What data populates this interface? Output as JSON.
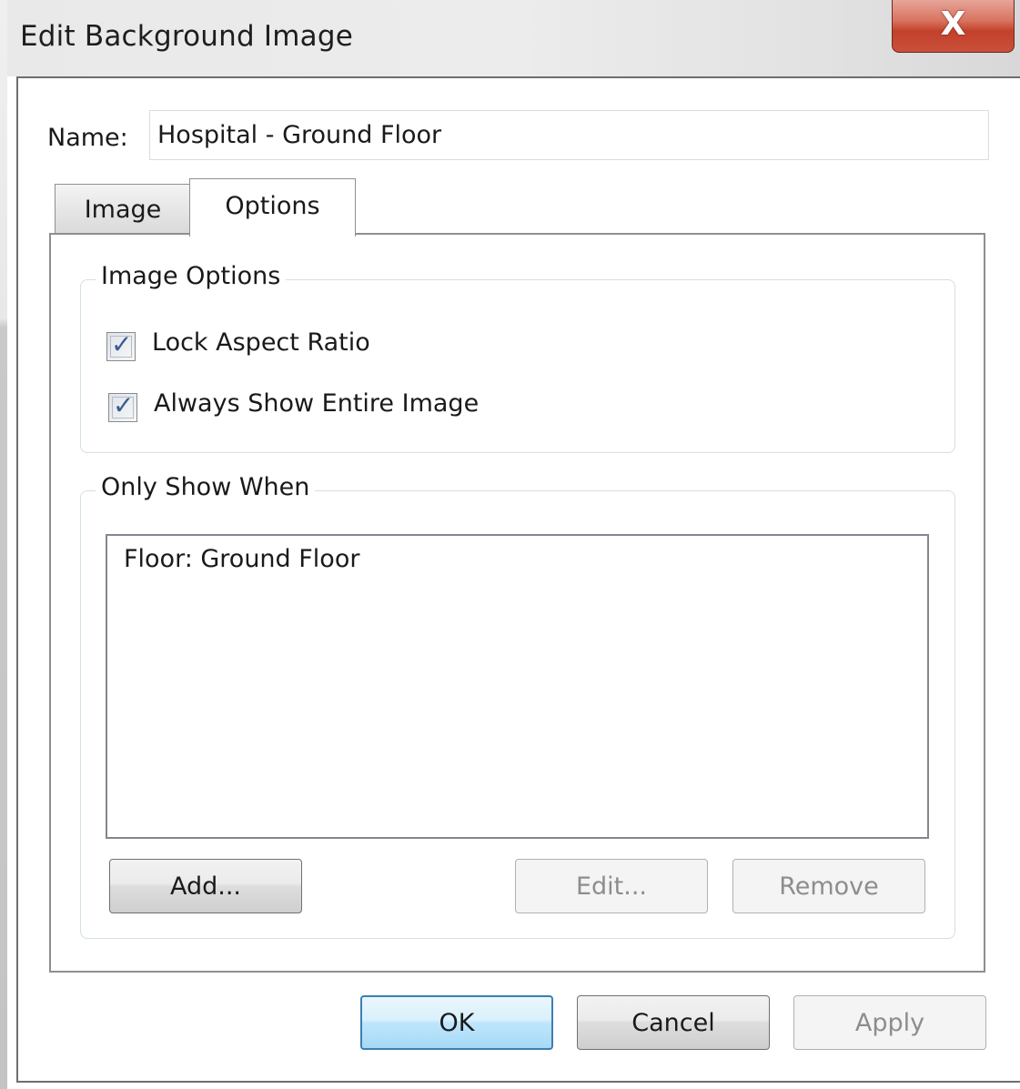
{
  "window": {
    "title": "Edit Background Image",
    "close_glyph": "X"
  },
  "name_field": {
    "label": "Name:",
    "value": "Hospital - Ground Floor"
  },
  "tabs": [
    {
      "label": "Image",
      "selected": false
    },
    {
      "label": "Options",
      "selected": true
    }
  ],
  "image_options": {
    "group_title": "Image Options",
    "lock_aspect_ratio": {
      "label": "Lock Aspect Ratio",
      "checked": true
    },
    "always_show_entire_image": {
      "label": "Always Show Entire Image",
      "checked": true
    }
  },
  "only_show_when": {
    "group_title": "Only Show When",
    "items": [
      "Floor: Ground Floor"
    ],
    "add_label": "Add...",
    "edit_label": "Edit...",
    "remove_label": "Remove"
  },
  "footer": {
    "ok_label": "OK",
    "cancel_label": "Cancel",
    "apply_label": "Apply"
  },
  "icons": {
    "close": "close-icon",
    "checkmark": "checkmark-icon"
  },
  "colors": {
    "close_button": "#c8503a",
    "default_button_border": "#3c7fb1",
    "checkmark": "#3c5b8f"
  }
}
